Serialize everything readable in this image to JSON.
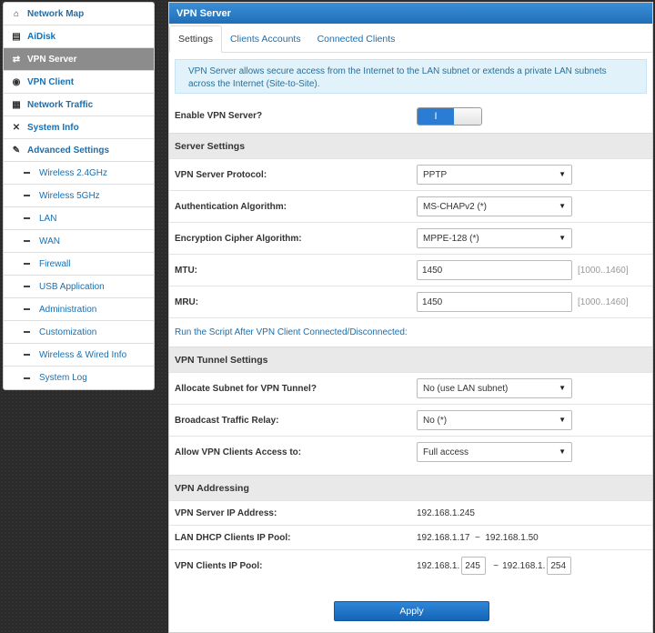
{
  "sidebar": {
    "items": [
      {
        "label": "Network Map",
        "icon": "home-icon",
        "glyph": "⌂"
      },
      {
        "label": "AiDisk",
        "icon": "disk-icon",
        "glyph": "▤"
      },
      {
        "label": "VPN Server",
        "icon": "vpn-server-icon",
        "glyph": "⇄"
      },
      {
        "label": "VPN Client",
        "icon": "globe-icon",
        "glyph": "◉"
      },
      {
        "label": "Network Traffic",
        "icon": "traffic-icon",
        "glyph": "▦"
      },
      {
        "label": "System Info",
        "icon": "shuffle-icon",
        "glyph": "✕"
      },
      {
        "label": "Advanced Settings",
        "icon": "wrench-icon",
        "glyph": "✎"
      }
    ],
    "sub_items": [
      "Wireless 2.4GHz",
      "Wireless 5GHz",
      "LAN",
      "WAN",
      "Firewall",
      "USB Application",
      "Administration",
      "Customization",
      "Wireless & Wired Info",
      "System Log"
    ]
  },
  "panel": {
    "title": "VPN Server",
    "tabs": [
      "Settings",
      "Clients Accounts",
      "Connected Clients"
    ],
    "info": "VPN Server allows secure access from the Internet to the LAN subnet or extends a private LAN subnets across the Internet (Site-to-Site).",
    "enable_label": "Enable VPN Server?",
    "enable_on_glyph": "I",
    "server_settings": {
      "title": "Server Settings",
      "protocol_label": "VPN Server Protocol:",
      "protocol_value": "PPTP",
      "auth_label": "Authentication Algorithm:",
      "auth_value": "MS-CHAPv2 (*)",
      "cipher_label": "Encryption Cipher Algorithm:",
      "cipher_value": "MPPE-128 (*)",
      "mtu_label": "MTU:",
      "mtu_value": "1450",
      "mtu_range": "[1000..1460]",
      "mru_label": "MRU:",
      "mru_value": "1450",
      "mru_range": "[1000..1460]",
      "script_link": "Run the Script After VPN Client Connected/Disconnected:"
    },
    "tunnel_settings": {
      "title": "VPN Tunnel Settings",
      "subnet_label": "Allocate Subnet for VPN Tunnel?",
      "subnet_value": "No (use LAN subnet)",
      "broadcast_label": "Broadcast Traffic Relay:",
      "broadcast_value": "No (*)",
      "access_label": "Allow VPN Clients Access to:",
      "access_value": "Full access"
    },
    "addressing": {
      "title": "VPN Addressing",
      "server_ip_label": "VPN Server IP Address:",
      "server_ip_value": "192.168.1.245",
      "dhcp_pool_label": "LAN DHCP Clients IP Pool:",
      "dhcp_pool_value": "192.168.1.17  ~  192.168.1.50",
      "clients_pool_label": "VPN Clients IP Pool:",
      "pool_prefix_start": "192.168.1.",
      "pool_start": "245",
      "pool_tilde": "~",
      "pool_prefix_end": "192.168.1.",
      "pool_end": "254"
    },
    "apply_label": "Apply"
  },
  "colors": {
    "accent": "#1f6fb8",
    "link": "#1a6fb0",
    "active_nav": "#8c8c8c"
  }
}
